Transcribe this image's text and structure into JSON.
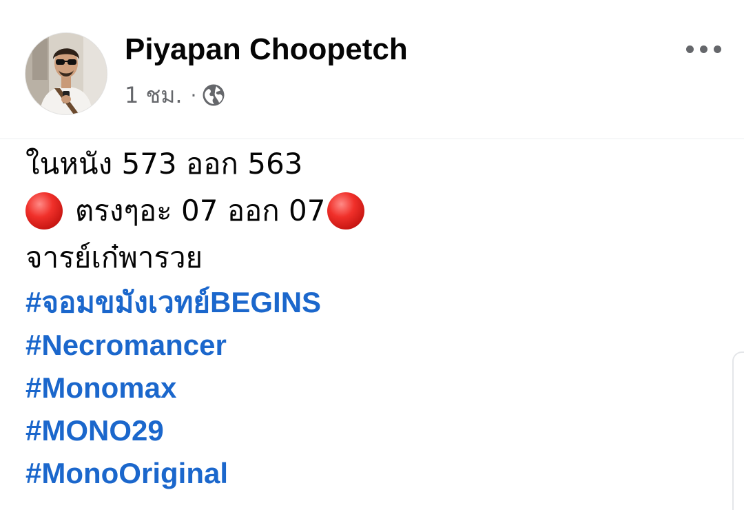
{
  "post": {
    "author": "Piyapan Choopetch",
    "time": "1 ชม.",
    "separator": "·",
    "privacy_icon": "globe-icon",
    "more_icon": "more-horizontal-icon",
    "avatar_icon": "profile-photo-avatar"
  },
  "body": {
    "line1": "ในหนัง 573 ออก 563",
    "line2_icon": "red-circle-emoji",
    "line2": "ตรงๆอะ 07 ออก 07",
    "line3": "จารย์เก๋พารวย"
  },
  "hashtags": [
    "#จอมขมังเวทย์BEGINS",
    "#Necromancer",
    "#Monomax",
    "#MONO29",
    "#MonoOriginal"
  ],
  "colors": {
    "hashtag": "#1b67cc",
    "text": "#050505",
    "meta": "#65676b",
    "emoji_red": "#e0241f"
  }
}
